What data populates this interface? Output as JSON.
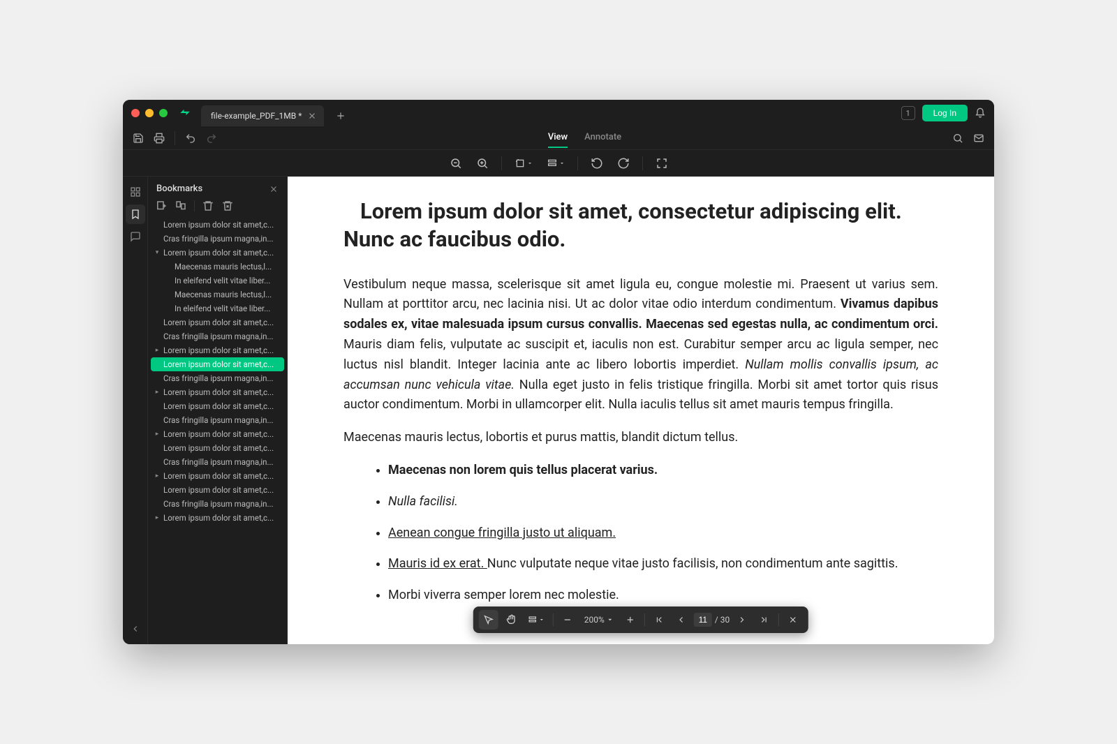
{
  "tab": {
    "title": "file-example_PDF_1MB *"
  },
  "header": {
    "badge": "1",
    "login": "Log In"
  },
  "modes": {
    "view": "View",
    "annotate": "Annotate"
  },
  "sidebar": {
    "title": "Bookmarks",
    "items": [
      {
        "label": "Lorem ipsum dolor sit amet,c...",
        "indent": 1,
        "chev": ""
      },
      {
        "label": "Cras fringilla ipsum magna,in...",
        "indent": 1,
        "chev": ""
      },
      {
        "label": "Lorem ipsum dolor sit amet,c...",
        "indent": 1,
        "chev": "down"
      },
      {
        "label": "Maecenas mauris lectus,l...",
        "indent": 2,
        "chev": ""
      },
      {
        "label": "In eleifend velit vitae liber...",
        "indent": 2,
        "chev": ""
      },
      {
        "label": "Maecenas mauris lectus,l...",
        "indent": 2,
        "chev": ""
      },
      {
        "label": "In eleifend velit vitae liber...",
        "indent": 2,
        "chev": ""
      },
      {
        "label": "Lorem ipsum dolor sit amet,c...",
        "indent": 1,
        "chev": ""
      },
      {
        "label": "Cras fringilla ipsum magna,in...",
        "indent": 1,
        "chev": ""
      },
      {
        "label": "Lorem ipsum dolor sit amet,c...",
        "indent": 1,
        "chev": "right"
      },
      {
        "label": "Lorem ipsum dolor sit amet,c...",
        "indent": 1,
        "chev": "",
        "selected": true
      },
      {
        "label": "Cras fringilla ipsum magna,in...",
        "indent": 1,
        "chev": ""
      },
      {
        "label": "Lorem ipsum dolor sit amet,c...",
        "indent": 1,
        "chev": "right"
      },
      {
        "label": "Lorem ipsum dolor sit amet,c...",
        "indent": 1,
        "chev": ""
      },
      {
        "label": "Cras fringilla ipsum magna,in...",
        "indent": 1,
        "chev": ""
      },
      {
        "label": "Lorem ipsum dolor sit amet,c...",
        "indent": 1,
        "chev": "right"
      },
      {
        "label": "Lorem ipsum dolor sit amet,c...",
        "indent": 1,
        "chev": ""
      },
      {
        "label": "Cras fringilla ipsum magna,in...",
        "indent": 1,
        "chev": ""
      },
      {
        "label": "Lorem ipsum dolor sit amet,c...",
        "indent": 1,
        "chev": "right"
      },
      {
        "label": "Lorem ipsum dolor sit amet,c...",
        "indent": 1,
        "chev": ""
      },
      {
        "label": "Cras fringilla ipsum magna,in...",
        "indent": 1,
        "chev": ""
      },
      {
        "label": "Lorem ipsum dolor sit amet,c...",
        "indent": 1,
        "chev": "right"
      }
    ]
  },
  "document": {
    "heading": "Lorem ipsum dolor sit amet, consectetur adipiscing elit. Nunc ac faucibus odio.",
    "p1_a": "Vestibulum neque massa, scelerisque sit amet ligula eu, congue molestie mi. Praesent ut varius sem. Nullam at porttitor arcu, nec lacinia nisi. Ut ac dolor vitae odio interdum condimentum. ",
    "p1_b": "Vivamus dapibus sodales ex, vitae malesuada ipsum cursus convallis. Maecenas sed egestas nulla, ac condimentum orci.",
    "p1_c": " Mauris diam felis, vulputate ac suscipit et, iaculis non est. Curabitur semper arcu ac ligula semper, nec luctus nisl blandit. Integer lacinia ante ac libero lobortis imperdiet. ",
    "p1_d": "Nullam mollis convallis ipsum, ac accumsan nunc vehicula vitae.",
    "p1_e": " Nulla eget justo in felis tristique fringilla. Morbi sit amet tortor quis risus auctor condimentum. Morbi in ullamcorper elit. Nulla iaculis tellus sit amet mauris tempus fringilla.",
    "p2": "Maecenas mauris lectus, lobortis et purus mattis, blandit dictum tellus.",
    "li1": "Maecenas non lorem quis tellus placerat varius.",
    "li2": "Nulla facilisi.",
    "li3": "Aenean congue fringilla justo ut aliquam. ",
    "li4_u": "Mauris id ex erat. ",
    "li4_rest": "Nunc vulputate neque vitae justo facilisis, non condimentum ante sagittis.",
    "li5": "Morbi viverra semper lorem nec molestie."
  },
  "footer": {
    "zoom": "200%",
    "page_current": "11",
    "page_total": "/ 30"
  }
}
